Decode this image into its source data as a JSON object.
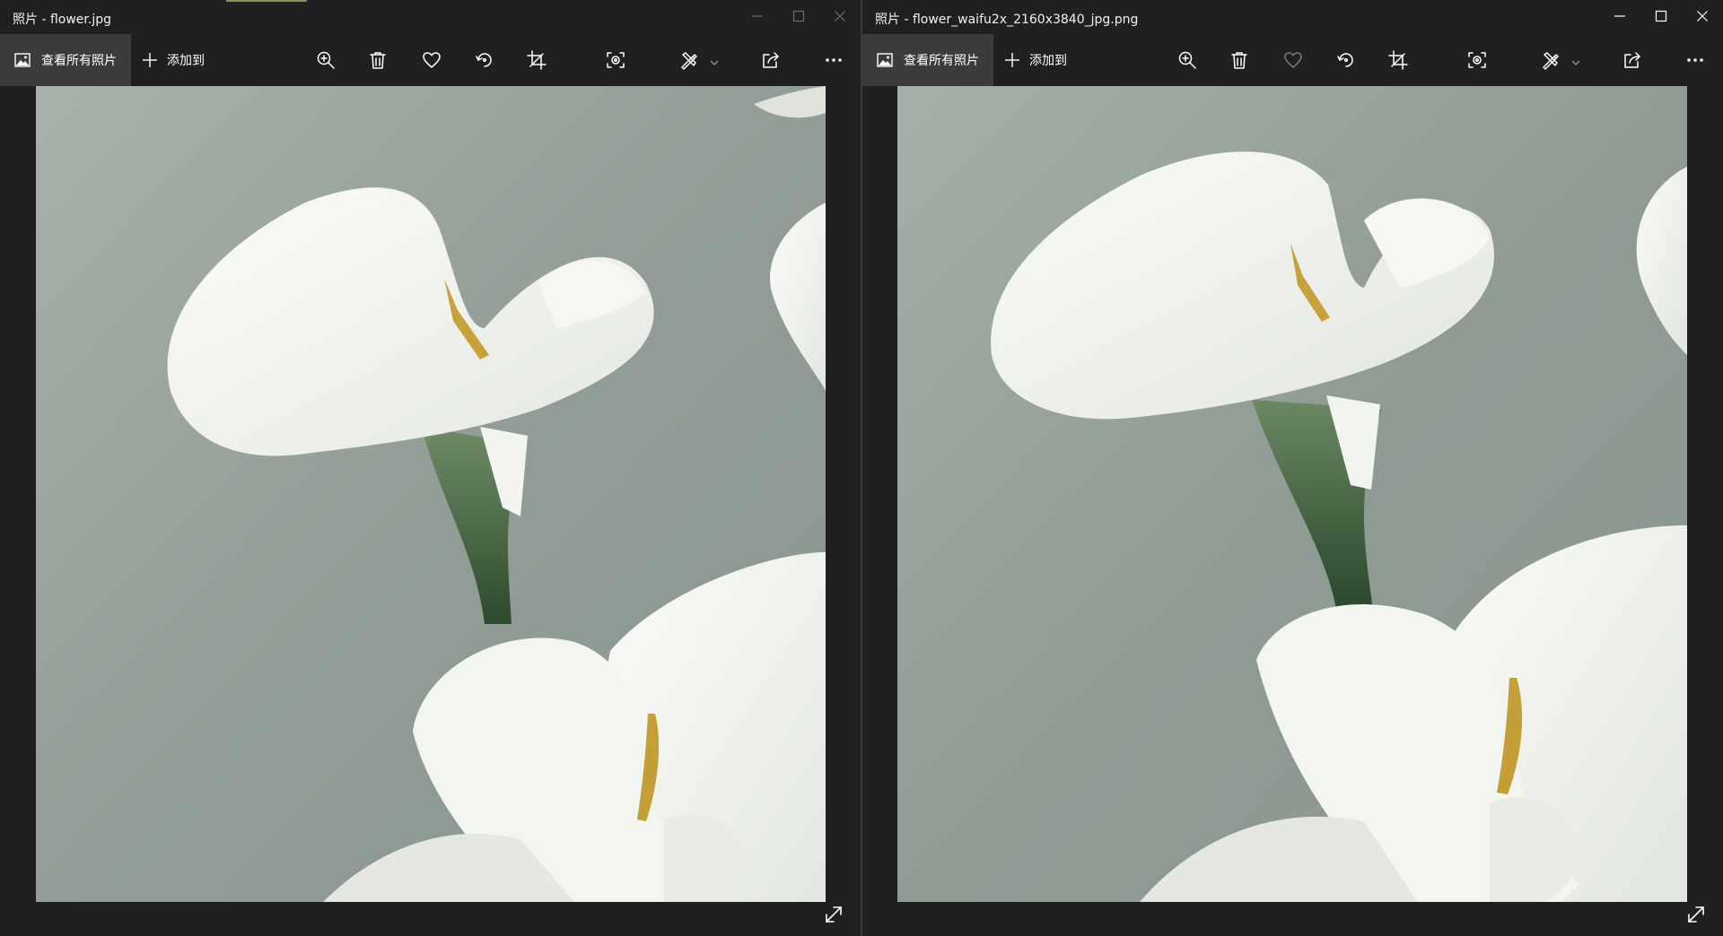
{
  "windows": [
    {
      "title": "照片 - flower.jpg",
      "view_all_label": "查看所有照片",
      "add_to_label": "添加到",
      "favorite_enabled": true,
      "window_controls_dimmed": true
    },
    {
      "title": "照片 - flower_waifu2x_2160x3840_jpg.png",
      "view_all_label": "查看所有照片",
      "add_to_label": "添加到",
      "favorite_enabled": false,
      "window_controls_dimmed": false
    }
  ],
  "toolbar_icons": [
    "zoom-in-icon",
    "delete-icon",
    "favorite-icon",
    "rotate-icon",
    "crop-icon",
    "enhance-icon",
    "edit-create-icon",
    "share-icon",
    "more-icon"
  ],
  "photo": {
    "subject": "white calla lilies",
    "background_color": "#8f9b94",
    "petal_color": "#f1f3ee",
    "stem_color": "#3d5f3b",
    "spadix_color": "#c9a43c"
  },
  "colors": {
    "window_bg": "#202020",
    "view_all_bg": "#3b3b3b"
  }
}
